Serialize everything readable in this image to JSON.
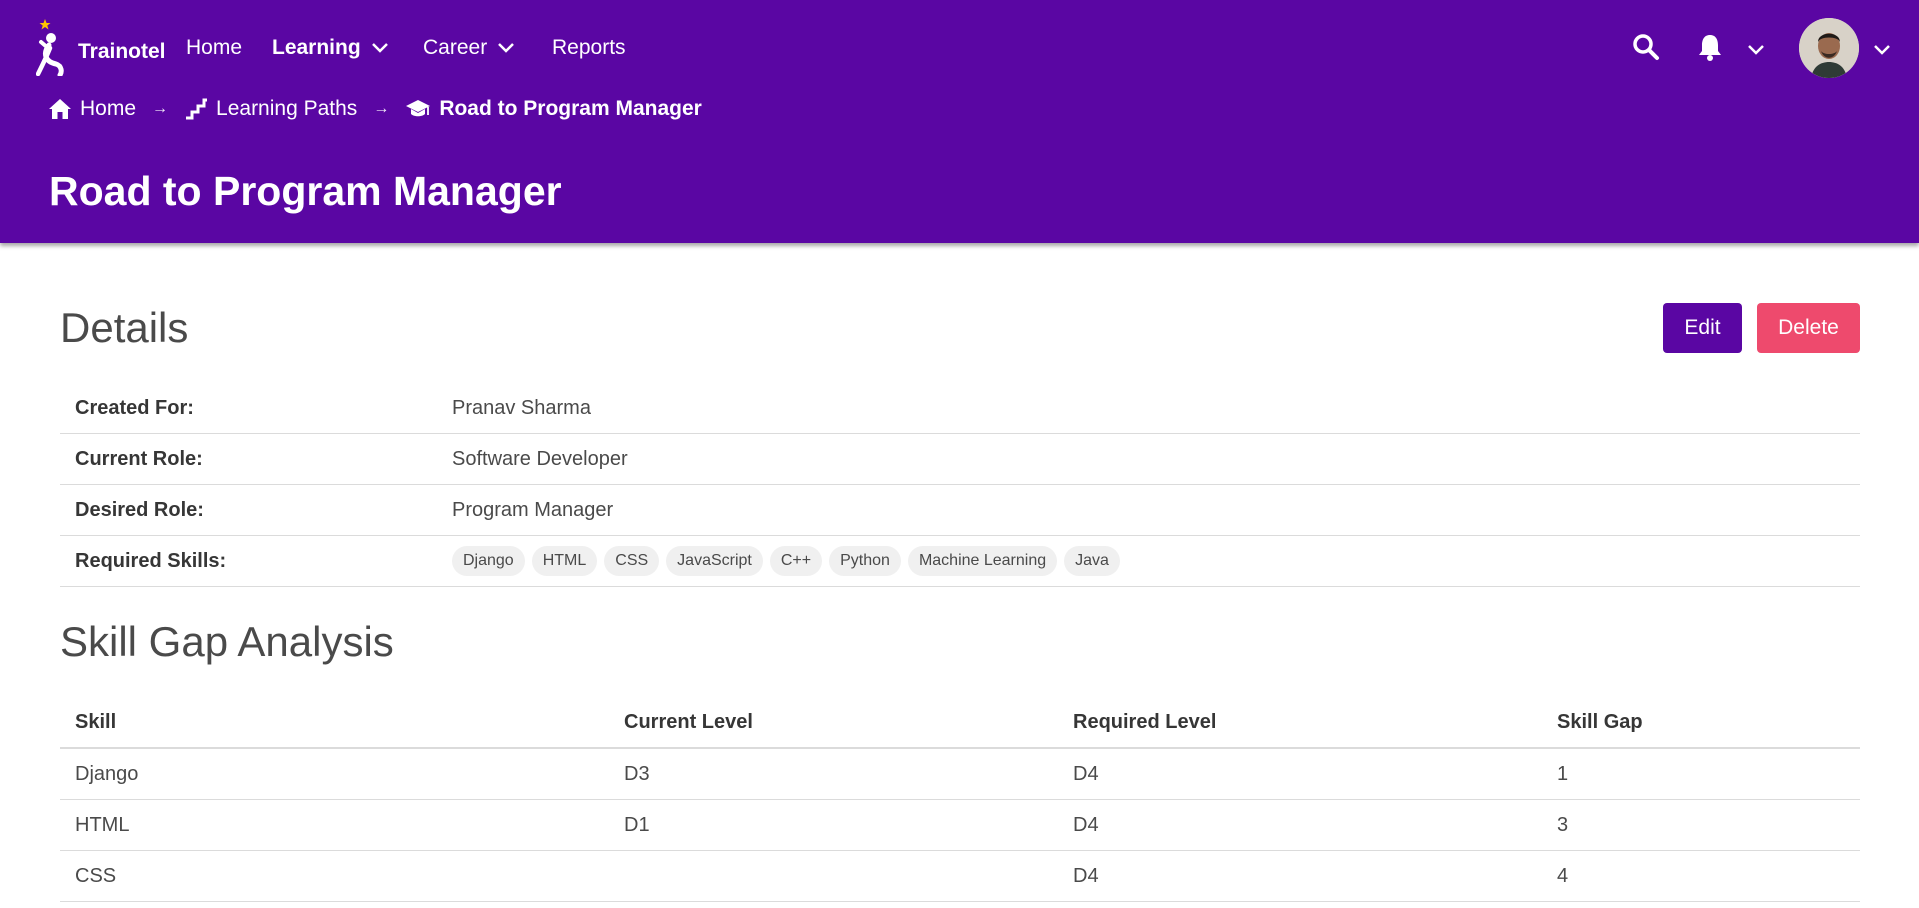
{
  "app": {
    "name": "Trainotel"
  },
  "nav": {
    "items": [
      {
        "label": "Home"
      },
      {
        "label": "Learning"
      },
      {
        "label": "Career"
      },
      {
        "label": "Reports"
      }
    ]
  },
  "breadcrumb": {
    "items": [
      {
        "label": "Home",
        "icon": "home-icon"
      },
      {
        "label": "Learning Paths",
        "icon": "stairs-icon"
      },
      {
        "label": "Road to Program Manager",
        "icon": "graduation-cap-icon"
      }
    ],
    "separator": "→"
  },
  "page": {
    "title": "Road to Program Manager"
  },
  "details": {
    "title": "Details",
    "edit_label": "Edit",
    "delete_label": "Delete",
    "rows": [
      {
        "key": "Created For:",
        "value": "Pranav Sharma"
      },
      {
        "key": "Current Role:",
        "value": "Software Developer"
      },
      {
        "key": "Desired Role:",
        "value": "Program Manager"
      },
      {
        "key": "Required Skills:"
      }
    ],
    "skills": [
      "Django",
      "HTML",
      "CSS",
      "JavaScript",
      "C++",
      "Python",
      "Machine Learning",
      "Java"
    ]
  },
  "skill_gap": {
    "title": "Skill Gap Analysis",
    "headers": [
      "Skill",
      "Current Level",
      "Required Level",
      "Skill Gap"
    ],
    "rows": [
      [
        "Django",
        "D3",
        "D4",
        "1"
      ],
      [
        "HTML",
        "D1",
        "D4",
        "3"
      ],
      [
        "CSS",
        "",
        "D4",
        "4"
      ]
    ]
  },
  "colors": {
    "primary": "#5a06a3",
    "danger": "#ee4a6d"
  }
}
